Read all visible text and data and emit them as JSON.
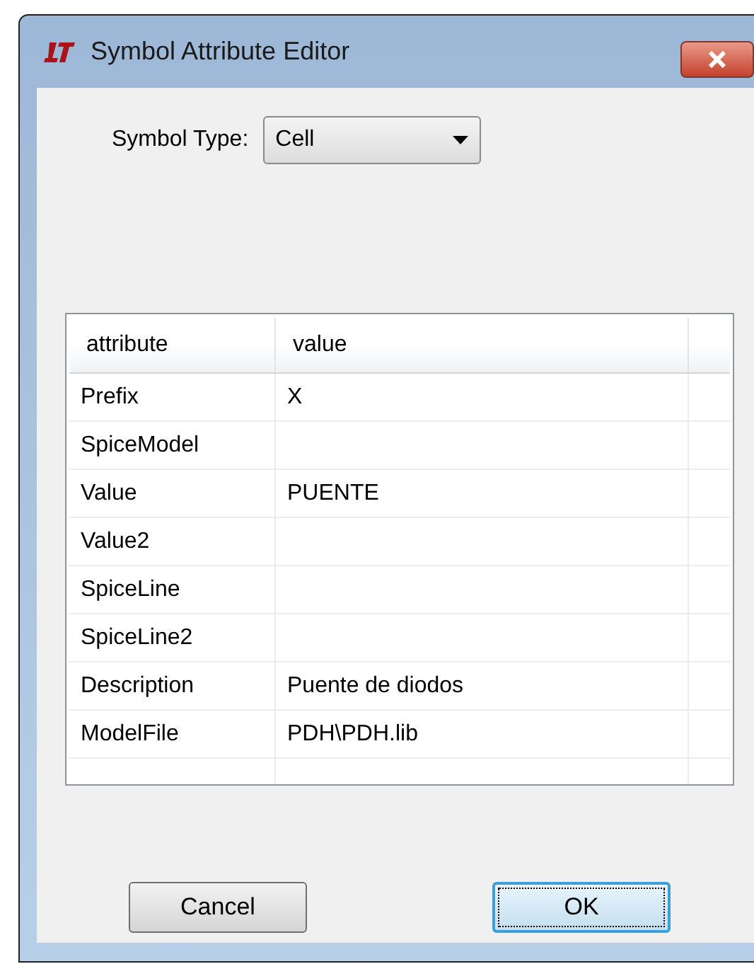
{
  "window": {
    "title": "Symbol Attribute Editor"
  },
  "symbol_type": {
    "label": "Symbol Type:",
    "value": "Cell"
  },
  "table": {
    "columns": [
      "attribute",
      "value"
    ],
    "rows": [
      {
        "attribute": "Prefix",
        "value": "X"
      },
      {
        "attribute": "SpiceModel",
        "value": ""
      },
      {
        "attribute": "Value",
        "value": "PUENTE"
      },
      {
        "attribute": "Value2",
        "value": ""
      },
      {
        "attribute": "SpiceLine",
        "value": ""
      },
      {
        "attribute": "SpiceLine2",
        "value": ""
      },
      {
        "attribute": "Description",
        "value": "Puente de diodos"
      },
      {
        "attribute": "ModelFile",
        "value": "PDH\\PDH.lib"
      }
    ]
  },
  "buttons": [
    {
      "label": "Cancel",
      "default": false
    },
    {
      "label": "OK",
      "default": true
    }
  ]
}
